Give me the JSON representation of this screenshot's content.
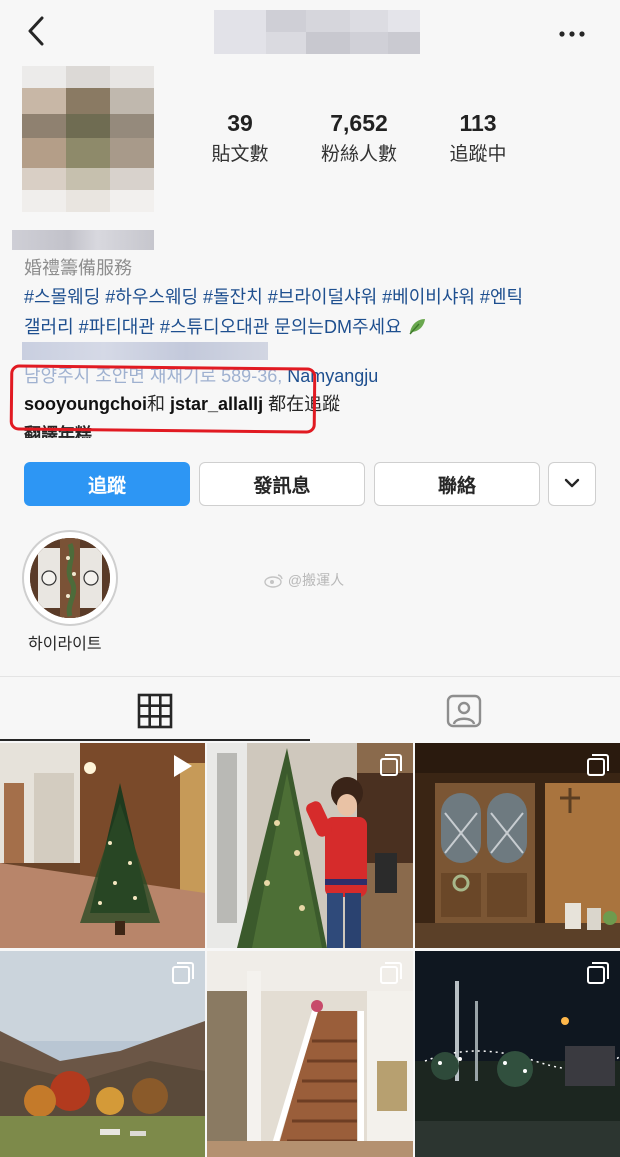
{
  "stats": [
    {
      "value": "39",
      "label": "貼文數"
    },
    {
      "value": "7,652",
      "label": "粉絲人數"
    },
    {
      "value": "113",
      "label": "追蹤中"
    }
  ],
  "profile": {
    "category": "婚禮籌備服務",
    "bio_line1": "#스몰웨딩 #하우스웨딩 #돌잔치 #브라이덜샤워 #베이비샤워 #엔틱",
    "bio_line2": "갤러리 #파티대관 #스튜디오대관 문의는DM주세요",
    "address_visible": "남양주시 조안면 재재기로 589-36,",
    "address_city": "Namyangju",
    "followed_user1": "sooyoungchoi",
    "followed_and": "和",
    "followed_user2": "jstar_allallj",
    "followed_suffix": "都在追蹤",
    "translate": "翻譯年糕"
  },
  "actions": {
    "follow": "追蹤",
    "message": "發訊息",
    "contact": "聯絡"
  },
  "highlight": {
    "label": "하이라이트"
  },
  "watermark": "@搬運人",
  "colors": {
    "follow_button": "#2d96f4",
    "link": "#1e4f8f",
    "annotation_circle": "#e11a22"
  },
  "posts": [
    {
      "name": "post-christmas-tree-deck",
      "badge": "video"
    },
    {
      "name": "post-woman-decorating-tree",
      "badge": "multiple"
    },
    {
      "name": "post-wooden-doors",
      "badge": "multiple"
    },
    {
      "name": "post-autumn-mountains",
      "badge": "multiple"
    },
    {
      "name": "post-white-staircase",
      "badge": "multiple"
    },
    {
      "name": "post-night-lights",
      "badge": "multiple"
    }
  ]
}
